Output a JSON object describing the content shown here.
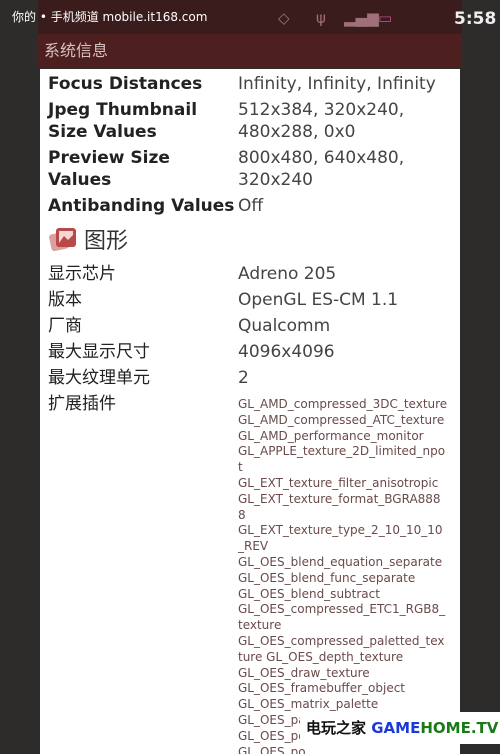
{
  "watermark": "你的 • 手机频道  mobile.it168.com",
  "status": {
    "time": "5:58",
    "icons": [
      "rotate-icon",
      "usb-icon",
      "signal-icon",
      "battery-icon"
    ]
  },
  "title": "系统信息",
  "camera": [
    {
      "label": "Focus Distances",
      "value": "Infinity, Infinity, Infinity"
    },
    {
      "label": "Jpeg Thumbnail Size Values",
      "value": "512x384, 320x240, 480x288, 0x0"
    },
    {
      "label": "Preview Size Values",
      "value": "800x480, 640x480, 320x240"
    },
    {
      "label": "Antibanding Values",
      "value": "Off"
    }
  ],
  "graphics": {
    "heading": "图形",
    "rows": [
      {
        "label": "显示芯片",
        "value": "Adreno 205"
      },
      {
        "label": "版本",
        "value": "OpenGL ES-CM 1.1"
      },
      {
        "label": "厂商",
        "value": "Qualcomm"
      },
      {
        "label": "最大显示尺寸",
        "value": "4096x4096"
      },
      {
        "label": "最大纹理单元",
        "value": "2"
      }
    ],
    "ext_label": "扩展插件",
    "extensions": [
      "GL_AMD_compressed_3DC_texture",
      "GL_AMD_compressed_ATC_texture",
      "GL_AMD_performance_monitor",
      "GL_APPLE_texture_2D_limited_npot",
      " GL_EXT_texture_filter_anisotropic",
      "GL_EXT_texture_format_BGRA8888",
      "GL_EXT_texture_type_2_10_10_10_REV",
      "GL_OES_blend_equation_separate",
      "GL_OES_blend_func_separate",
      "GL_OES_blend_subtract",
      "GL_OES_compressed_ETC1_RGB8_texture",
      "GL_OES_compressed_paletted_texture GL_OES_depth_texture",
      "GL_OES_draw_texture",
      "GL_OES_framebuffer_object",
      "GL_OES_matrix_palette",
      "GL_OES_packed_depth_stencil",
      "GL_OES_po",
      "GL_OES_po",
      "GL_OES_rea"
    ]
  },
  "logo": {
    "cn": "电玩之家",
    "en1": "GAME",
    "en2": "HOME.TV"
  }
}
